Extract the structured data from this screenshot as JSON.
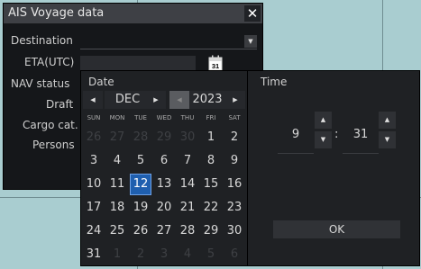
{
  "window": {
    "title": "AIS Voyage data",
    "close_glyph": "✕",
    "labels": {
      "destination": "Destination",
      "eta": "ETA(UTC)",
      "nav_status": "NAV status",
      "draft": "Draft",
      "cargo": "Cargo cat.",
      "persons": "Persons"
    },
    "destination_value": "",
    "eta_value": "",
    "calendar_icon_day": "31"
  },
  "date_picker": {
    "title": "Date",
    "month": "DEC",
    "year": "2023",
    "prev_glyph": "◀",
    "next_glyph": "▶",
    "weekdays": [
      "SUN",
      "MON",
      "TUE",
      "WED",
      "THU",
      "FRI",
      "SAT"
    ],
    "weeks": [
      [
        "26",
        "27",
        "28",
        "29",
        "30",
        "1",
        "2"
      ],
      [
        "3",
        "4",
        "5",
        "6",
        "7",
        "8",
        "9"
      ],
      [
        "10",
        "11",
        "12",
        "13",
        "14",
        "15",
        "16"
      ],
      [
        "17",
        "18",
        "19",
        "20",
        "21",
        "22",
        "23"
      ],
      [
        "24",
        "25",
        "26",
        "27",
        "28",
        "29",
        "30"
      ],
      [
        "31",
        "1",
        "2",
        "3",
        "4",
        "5",
        "6"
      ]
    ],
    "selected_day": "12"
  },
  "time_picker": {
    "title": "Time",
    "hour": "9",
    "minute": "31",
    "separator": ":",
    "up_glyph": "▲",
    "down_glyph": "▼",
    "ok_label": "OK"
  },
  "colors": {
    "background": "#a9cdd0",
    "panel": "#1f2124",
    "selected": "#1f5faf"
  }
}
